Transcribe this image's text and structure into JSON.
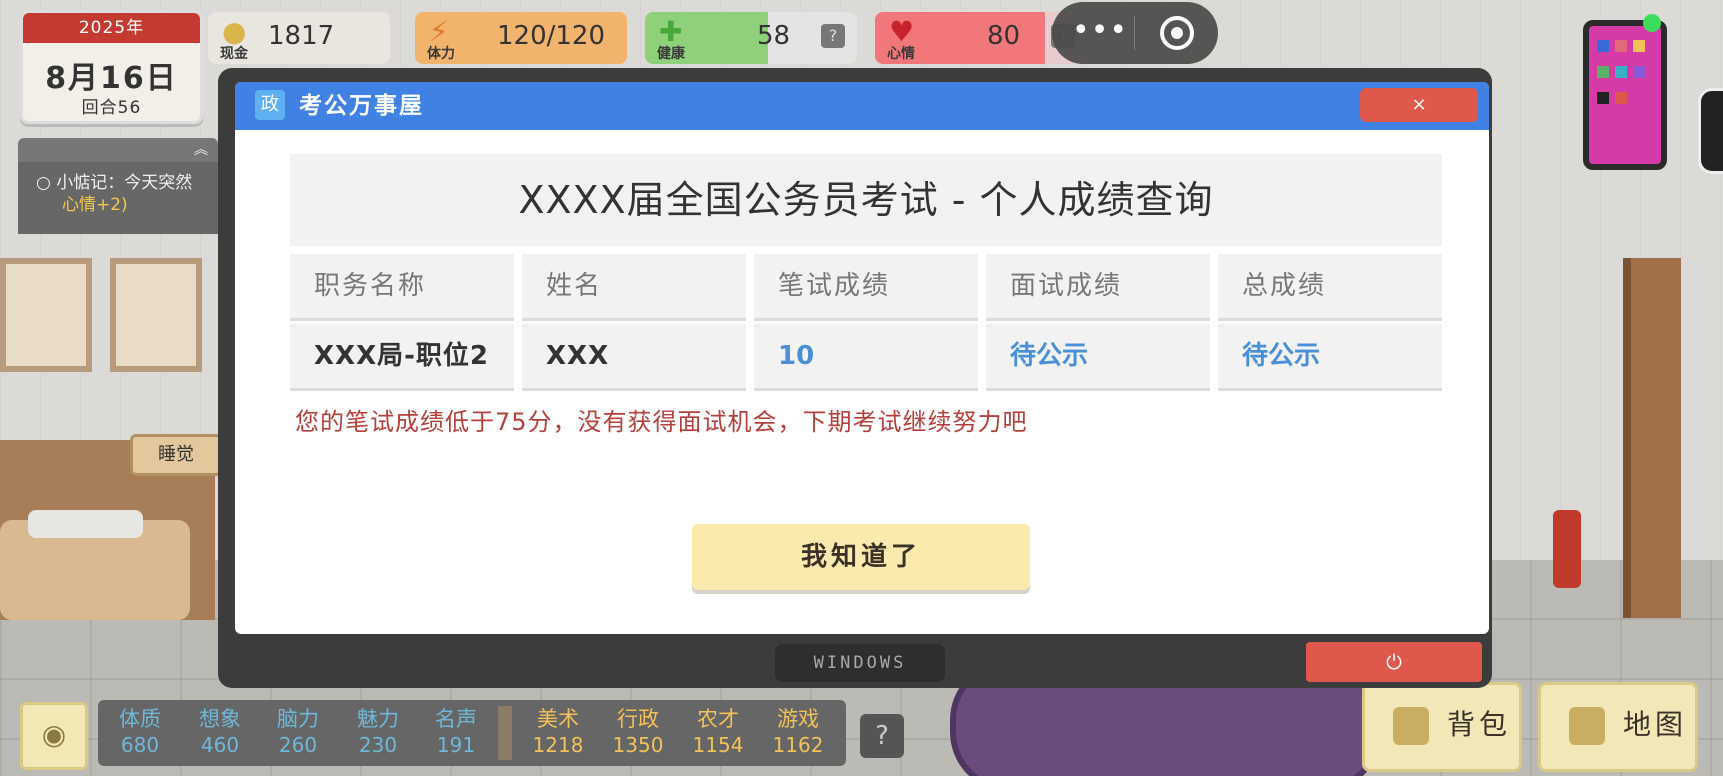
{
  "hud": {
    "year": "2025年",
    "date": "8月16日",
    "round": "回合56",
    "cash": {
      "label": "现金",
      "value": "1817",
      "icon": "coin-icon",
      "color": "#e7c86c"
    },
    "energy": {
      "label": "体力",
      "value": "120/120",
      "icon": "lightning-icon",
      "color": "#f2b36c",
      "level": 1.0
    },
    "health": {
      "label": "健康",
      "value": "58",
      "icon": "cross-icon",
      "color": "#8fd07a",
      "level": 0.58
    },
    "mood": {
      "label": "心情",
      "value": "80",
      "icon": "heart-icon",
      "color": "#f2777a",
      "level": 0.8
    },
    "help_glyph": "?",
    "capsule_more": "•••"
  },
  "note": {
    "prefix": "小惦记：今天突然",
    "suffix": "心情+2)"
  },
  "scene": {
    "sleep_label": "睡觉"
  },
  "modal": {
    "app_icon_text": "政",
    "app_title": "考公万事屋",
    "close_label": "×",
    "panel_title": "XXXX届全国公务员考试 - 个人成绩查询",
    "columns": [
      "职务名称",
      "姓名",
      "笔试成绩",
      "面试成绩",
      "总成绩"
    ],
    "row": [
      "XXX局-职位2",
      "XXX",
      "10",
      "待公示",
      "待公示"
    ],
    "message": "您的笔试成绩低于75分，没有获得面试机会，下期考试继续努力吧",
    "ok_label": "我知道了",
    "taskbar_label": "WINDOWS",
    "power_glyph": "⏻"
  },
  "attributes": [
    {
      "name": "体质",
      "value": "680",
      "color": "#6fb7d8"
    },
    {
      "name": "想象",
      "value": "460",
      "color": "#6fb7d8"
    },
    {
      "name": "脑力",
      "value": "260",
      "color": "#6fb7d8"
    },
    {
      "name": "魅力",
      "value": "230",
      "color": "#6fb7d8"
    },
    {
      "name": "名声",
      "value": "191",
      "color": "#6fb7d8"
    },
    {
      "name": "美术",
      "value": "1218",
      "color": "#f2c15a"
    },
    {
      "name": "行政",
      "value": "1350",
      "color": "#f2c15a"
    },
    {
      "name": "农才",
      "value": "1154",
      "color": "#f2c15a"
    },
    {
      "name": "游戏",
      "value": "1162",
      "color": "#f2c15a"
    }
  ],
  "bottom": {
    "eye_icon": "eye-icon",
    "help_glyph": "?",
    "backpack_label": "背包",
    "map_label": "地图"
  }
}
